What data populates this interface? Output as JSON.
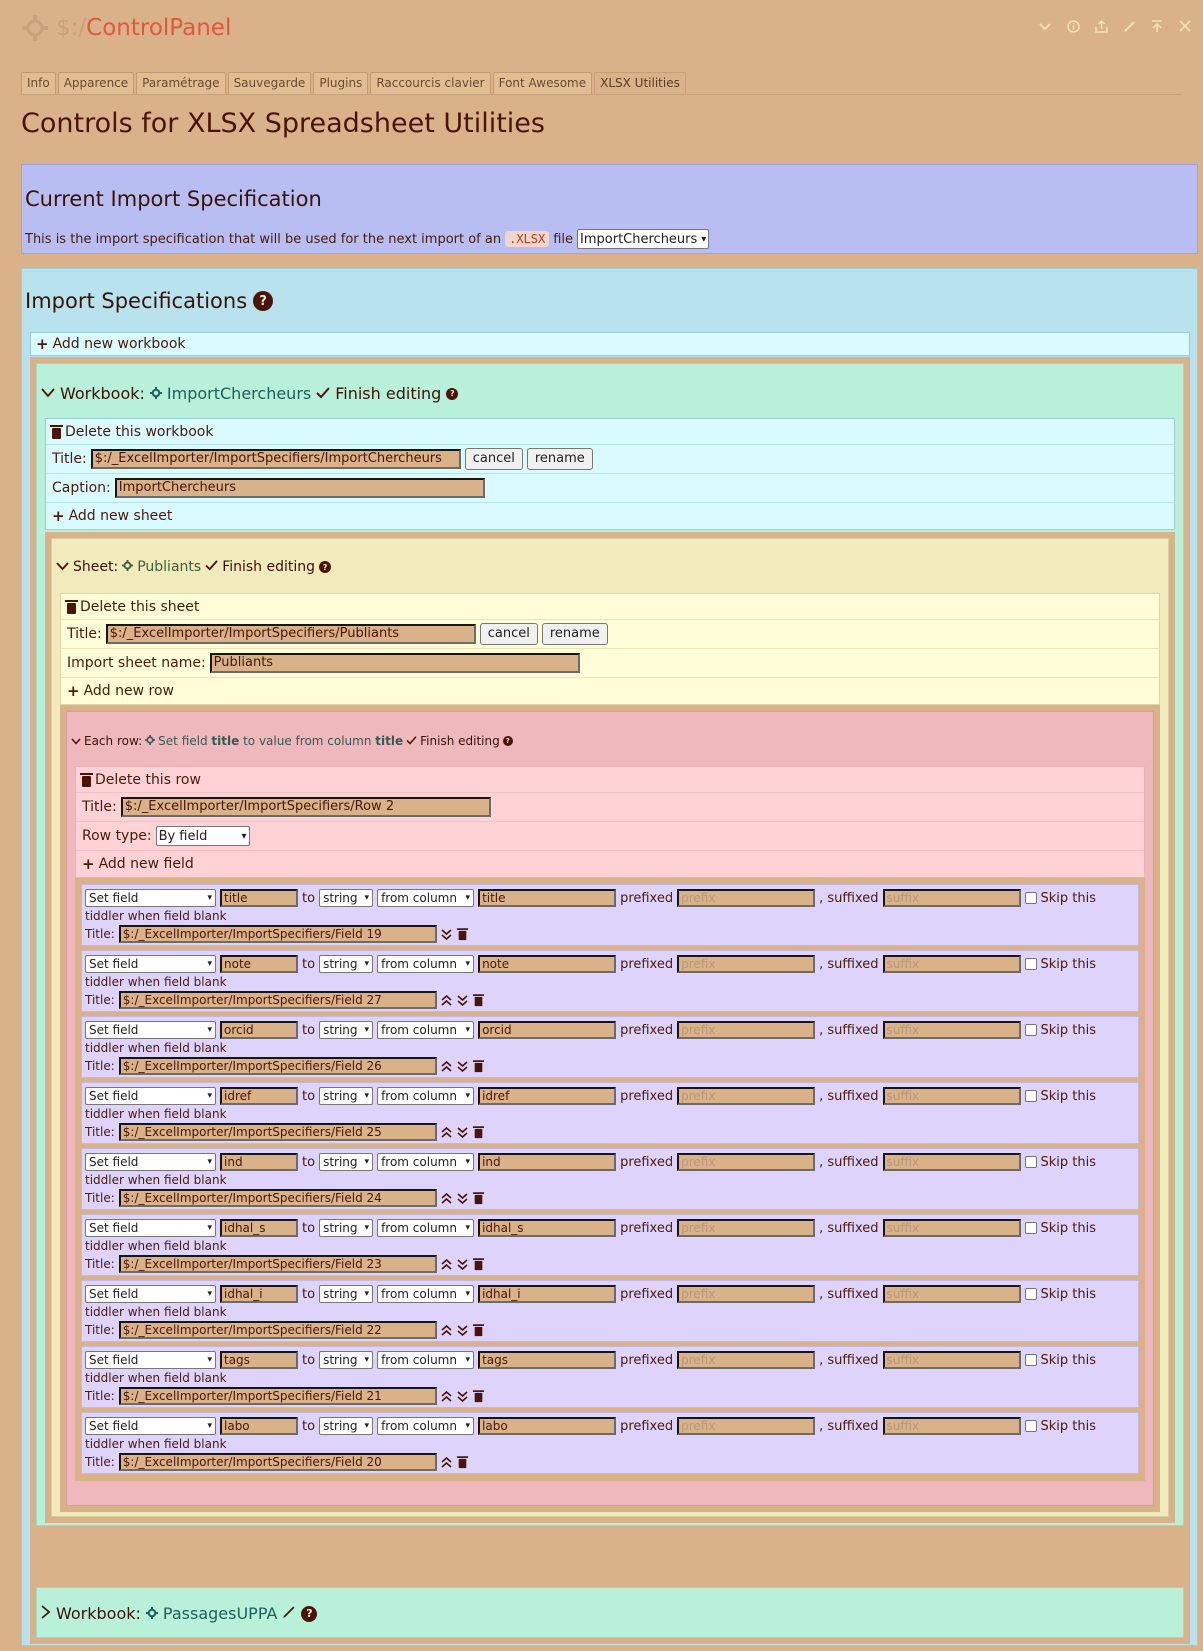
{
  "app": {
    "title_prefix": "$:/",
    "title": "ControlPanel"
  },
  "titlebar_icons": [
    "chevron-down-icon",
    "info-icon",
    "export-icon",
    "edit-icon",
    "close-others-icon",
    "close-icon"
  ],
  "tabs": [
    {
      "label": "Info"
    },
    {
      "label": "Apparence"
    },
    {
      "label": "Paramétrage"
    },
    {
      "label": "Sauvegarde"
    },
    {
      "label": "Plugins"
    },
    {
      "label": "Raccourcis clavier"
    },
    {
      "label": "Font Awesome"
    },
    {
      "label": "XLSX Utilities"
    }
  ],
  "page_title": "Controls for XLSX Spreadsheet Utilities",
  "current": {
    "heading": "Current Import Specification",
    "desc_before": "This is the import specification that will be used for the next import of an",
    "code": ".XLSX",
    "desc_after": "file",
    "selected": "ImportChercheurs"
  },
  "specs": {
    "heading": "Import Specifications",
    "add_workbook": "Add new workbook",
    "workbook1": {
      "label": "Workbook:",
      "name": "ImportChercheurs",
      "finish": "Finish editing",
      "delete": "Delete this workbook",
      "title_label": "Title:",
      "title_value": "$:/_ExcelImporter/ImportSpecifiers/ImportChercheurs",
      "cancel": "cancel",
      "rename": "rename",
      "caption_label": "Caption:",
      "caption_value": "ImportChercheurs",
      "add_sheet": "Add new sheet"
    },
    "sheet": {
      "label": "Sheet:",
      "name": "Publiants",
      "finish": "Finish editing",
      "delete": "Delete this sheet",
      "title_label": "Title:",
      "title_value": "$:/_ExcelImporter/ImportSpecifiers/Publiants",
      "cancel": "cancel",
      "rename": "rename",
      "import_label": "Import sheet name:",
      "import_value": "Publiants",
      "add_row": "Add new row"
    },
    "row": {
      "label": "Each row:",
      "summary_1": "Set field",
      "summary_field": "title",
      "summary_2": "to value from column",
      "summary_col": "title",
      "finish": "Finish editing",
      "delete": "Delete this row",
      "title_label": "Title:",
      "title_value": "$:/_ExcelImporter/ImportSpecifiers/Row 2",
      "type_label": "Row type:",
      "type_value": "By field",
      "add_field": "Add new field"
    },
    "field_labels": {
      "op": "Set field",
      "to": "to",
      "type": "string",
      "from": "from column",
      "prefixed": "prefixed",
      "prefix_ph": "prefix",
      "suffixed": ", suffixed",
      "suffix_ph": "suffix",
      "skip1": "Skip this",
      "skip2": "tiddler when field blank",
      "title_label": "Title:"
    },
    "fields": [
      {
        "field": "title",
        "column": "title",
        "title": "$:/_ExcelImporter/ImportSpecifiers/Field 19"
      },
      {
        "field": "note",
        "column": "note",
        "title": "$:/_ExcelImporter/ImportSpecifiers/Field 27"
      },
      {
        "field": "orcid",
        "column": "orcid",
        "title": "$:/_ExcelImporter/ImportSpecifiers/Field 26"
      },
      {
        "field": "idref",
        "column": "idref",
        "title": "$:/_ExcelImporter/ImportSpecifiers/Field 25"
      },
      {
        "field": "ind",
        "column": "ind",
        "title": "$:/_ExcelImporter/ImportSpecifiers/Field 24"
      },
      {
        "field": "idhal_s",
        "column": "idhal_s",
        "title": "$:/_ExcelImporter/ImportSpecifiers/Field 23"
      },
      {
        "field": "idhal_i",
        "column": "idhal_i",
        "title": "$:/_ExcelImporter/ImportSpecifiers/Field 22"
      },
      {
        "field": "tags",
        "column": "tags",
        "title": "$:/_ExcelImporter/ImportSpecifiers/Field 21"
      },
      {
        "field": "labo",
        "column": "labo",
        "title": "$:/_ExcelImporter/ImportSpecifiers/Field 20"
      }
    ],
    "workbook2": {
      "label": "Workbook:",
      "name": "PassagesUPPA"
    }
  }
}
